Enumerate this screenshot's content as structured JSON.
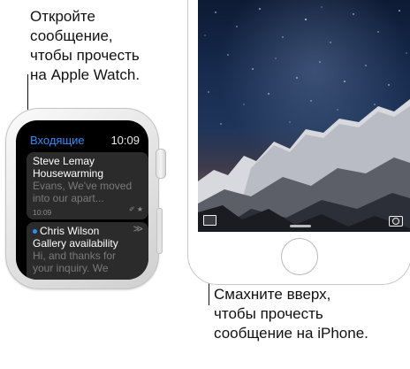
{
  "callouts": {
    "watch_text": "Откройте\nсообщение,\nчтобы прочесть\nна Apple Watch.",
    "phone_text": "Смахните вверх,\nчтобы прочесть\nсообщение на iPhone."
  },
  "watch": {
    "header": {
      "title": "Входящие",
      "time": "10:09"
    },
    "messages": [
      {
        "sender": "Steve Lemay",
        "subject": "Housewarming",
        "preview_1": "Evans, We've moved",
        "preview_2": "into our apart...",
        "time": "10:09",
        "icons": "✐ ★"
      },
      {
        "sender": "Chris Wilson",
        "subject": "Gallery availability",
        "preview_1": "Hi, and thanks for",
        "preview_2": "your inquiry. We",
        "unread": true,
        "chevrons": "≫"
      }
    ]
  },
  "iphone": {
    "icons": [
      "mail-icon",
      "camera-icon"
    ]
  },
  "colors": {
    "accent_blue": "#2f8cff",
    "watch_card": "#2b2b2b",
    "watch_case": "#e6e6e6"
  }
}
